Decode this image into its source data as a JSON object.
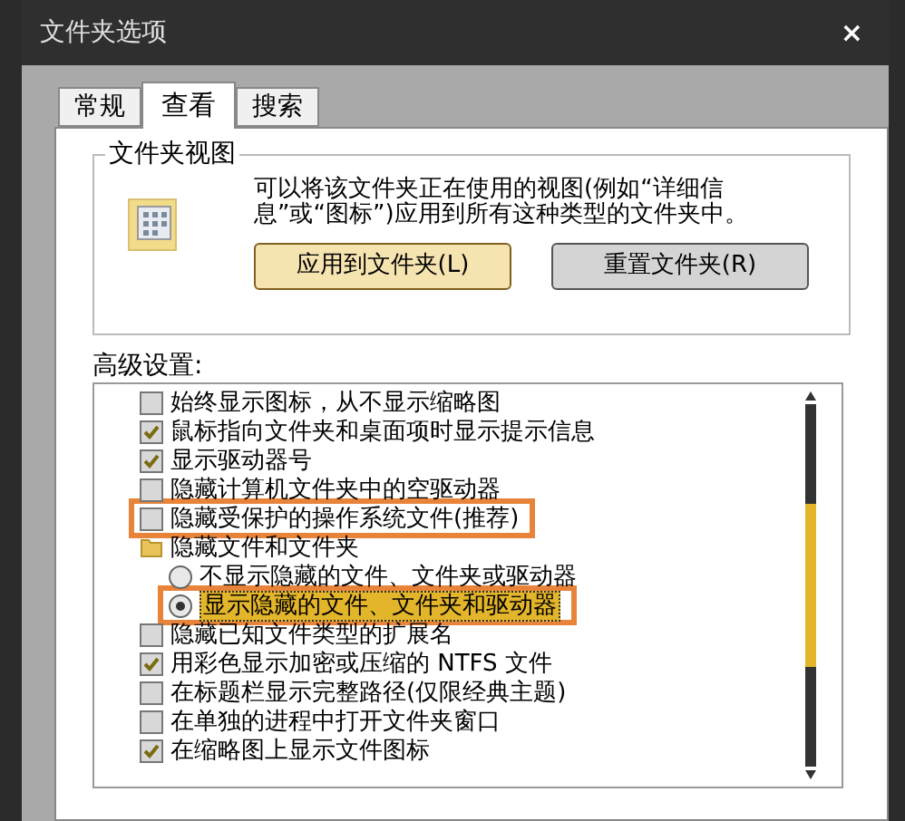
{
  "window": {
    "title": "文件夹选项",
    "close": "×"
  },
  "tabs": [
    {
      "label": "常规",
      "selected": false
    },
    {
      "label": "查看",
      "selected": true
    },
    {
      "label": "搜索",
      "selected": false
    }
  ],
  "folder_views": {
    "title": "文件夹视图",
    "description": "可以将该文件夹正在使用的视图(例如“详细信息”或“图标”)应用到所有这种类型的文件夹中。",
    "buttons": [
      {
        "label": "应用到文件夹(L)",
        "default": true
      },
      {
        "label": "重置文件夹(R)",
        "default": false
      }
    ]
  },
  "advanced": {
    "title": "高级设置:",
    "items": [
      {
        "kind": "checkbox",
        "label": "始终显示图标，从不显示缩略图",
        "checked": false,
        "highlighted": false
      },
      {
        "kind": "checkbox",
        "label": "鼠标指向文件夹和桌面项时显示提示信息",
        "checked": true,
        "highlighted": false
      },
      {
        "kind": "checkbox",
        "label": "显示驱动器号",
        "checked": true,
        "highlighted": false
      },
      {
        "kind": "checkbox",
        "label": "隐藏计算机文件夹中的空驱动器",
        "checked": false,
        "highlighted": false
      },
      {
        "kind": "checkbox",
        "label": "隐藏受保护的操作系统文件(推荐)",
        "checked": false,
        "highlighted": true
      },
      {
        "kind": "folder",
        "label": "隐藏文件和文件夹",
        "highlighted": false
      },
      {
        "kind": "radio",
        "label": "不显示隐藏的文件、文件夹或驱动器",
        "checked": false,
        "highlighted": false
      },
      {
        "kind": "radio",
        "label": "显示隐藏的文件、文件夹和驱动器",
        "checked": true,
        "highlighted": true
      },
      {
        "kind": "checkbox",
        "label": "隐藏已知文件类型的扩展名",
        "checked": false,
        "highlighted": false
      },
      {
        "kind": "checkbox",
        "label": "用彩色显示加密或压缩的 NTFS 文件",
        "checked": true,
        "highlighted": false
      },
      {
        "kind": "checkbox",
        "label": "在标题栏显示完整路径(仅限经典主题)",
        "checked": false,
        "highlighted": false
      },
      {
        "kind": "checkbox",
        "label": "在单独的进程中打开文件夹窗口",
        "checked": false,
        "highlighted": false
      },
      {
        "kind": "checkbox",
        "label": "在缩略图上显示文件图标",
        "checked": true,
        "highlighted": false
      }
    ]
  }
}
